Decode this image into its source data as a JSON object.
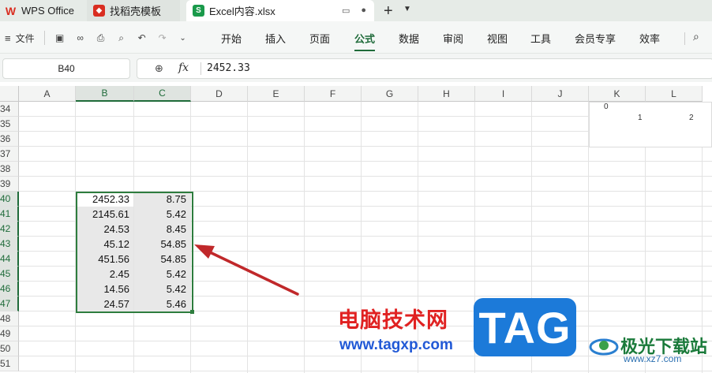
{
  "tabs": [
    {
      "label": "WPS Office",
      "icon": "wps-logo-icon",
      "color": "#d92d20"
    },
    {
      "label": "找稻壳模板",
      "icon": "docer-icon",
      "color": "#d92d20"
    },
    {
      "label": "Excel内容.xlsx",
      "icon": "spreadsheet-icon",
      "color": "#1a9a4b"
    }
  ],
  "ribbon": {
    "file_label": "文件",
    "menus": [
      "开始",
      "插入",
      "页面",
      "公式",
      "数据",
      "审阅",
      "视图",
      "工具",
      "会员专享",
      "效率"
    ],
    "active_menu": "公式"
  },
  "formula_bar": {
    "name_box": "B40",
    "fx_label": "fx",
    "value": "2452.33"
  },
  "columns": [
    "A",
    "B",
    "C",
    "D",
    "E",
    "F",
    "G",
    "H",
    "I",
    "J",
    "K",
    "L"
  ],
  "rows": [
    "34",
    "35",
    "36",
    "37",
    "38",
    "39",
    "40",
    "41",
    "42",
    "43",
    "44",
    "45",
    "46",
    "47",
    "48",
    "49",
    "50",
    "51"
  ],
  "data": {
    "B": [
      "2452.33",
      "2145.61",
      "24.53",
      "45.12",
      "451.56",
      "2.45",
      "14.56",
      "24.57"
    ],
    "C": [
      "8.75",
      "5.42",
      "8.45",
      "54.85",
      "54.85",
      "5.42",
      "5.42",
      "5.46"
    ]
  },
  "chart": {
    "y_tick": "0",
    "x_ticks": [
      "1",
      "2"
    ]
  },
  "watermarks": {
    "site_cn": "电脑技术网",
    "site_url": "www.tagxp.com",
    "tag": "TAG",
    "brand_cn": "极光下载站",
    "brand_url": "www.xz7.com"
  },
  "colors": {
    "accent": "#1f6b3a",
    "selection": "#2e7d3e",
    "arrow": "#c0282a"
  }
}
